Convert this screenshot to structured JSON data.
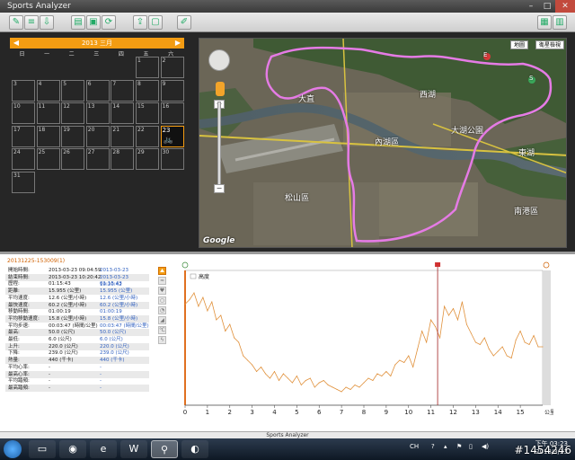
{
  "window": {
    "title": "Sports Analyzer"
  },
  "calendar": {
    "month_label": "2013 三月",
    "dows": [
      "日",
      "一",
      "二",
      "三",
      "四",
      "五",
      "六"
    ],
    "days": [
      "1",
      "2",
      "3",
      "4",
      "5",
      "6",
      "7",
      "8",
      "9",
      "10",
      "11",
      "12",
      "13",
      "14",
      "15",
      "16",
      "17",
      "18",
      "19",
      "20",
      "21",
      "22",
      "23",
      "24",
      "25",
      "26",
      "27",
      "28",
      "29",
      "30",
      "31"
    ],
    "selected_day": "23",
    "first_weekday": 5
  },
  "map": {
    "type_buttons": [
      "地圖",
      "衛星檢視"
    ],
    "labels": [
      "內湖區",
      "松山區",
      "大直",
      "大湖公園",
      "西湖",
      "東湖",
      "南港區"
    ],
    "google_logo": "Google",
    "route_markers": [
      "S",
      "E"
    ]
  },
  "activity": {
    "file_name": "20131225-153009(1)",
    "stats": [
      {
        "k": "開始時間:",
        "v1": "2013-03-23 09:04:59",
        "v2": "2013-03-23 09:04:59"
      },
      {
        "k": "結束時間:",
        "v1": "2013-03-23 10:20:42",
        "v2": "2013-03-23 10:20:42"
      },
      {
        "k": "歷程:",
        "v1": "01:15:43",
        "v2": "01:15:43"
      },
      {
        "k": "距離:",
        "v1": "15.955 (公里)",
        "v2": "15.955 (公里)"
      },
      {
        "k": "平均速度:",
        "v1": "12.6 (公里/小時)",
        "v2": "12.6 (公里/小時)"
      },
      {
        "k": "最快速度:",
        "v1": "60.2 (公里/小時)",
        "v2": "60.2 (公里/小時)"
      },
      {
        "k": "移動時間:",
        "v1": "01:00:19",
        "v2": "01:00:19"
      },
      {
        "k": "平均移動速度:",
        "v1": "15.8 (公里/小時)",
        "v2": "15.8 (公里/小時)"
      },
      {
        "k": "平均步速:",
        "v1": "00:03:47 (時間/公里)",
        "v2": "00:03:47 (時間/公里)"
      },
      {
        "k": "最高:",
        "v1": "50.0 (公尺)",
        "v2": "50.0 (公尺)"
      },
      {
        "k": "最低:",
        "v1": "6.0 (公尺)",
        "v2": "6.0 (公尺)"
      },
      {
        "k": "上升:",
        "v1": "220.0 (公尺)",
        "v2": "220.0 (公尺)"
      },
      {
        "k": "下降:",
        "v1": "239.0 (公尺)",
        "v2": "239.0 (公尺)"
      },
      {
        "k": "熱量:",
        "v1": "440 (千卡)",
        "v2": "440 (千卡)"
      },
      {
        "k": "平均心率:",
        "v1": "-",
        "v2": "-"
      },
      {
        "k": "最高心率:",
        "v1": "-",
        "v2": "-"
      },
      {
        "k": "平均踏頻:",
        "v1": "-",
        "v2": "-"
      },
      {
        "k": "最高踏頻:",
        "v1": "-",
        "v2": "-"
      }
    ]
  },
  "chart_data": {
    "type": "line",
    "legend": [
      "高度"
    ],
    "xlabel": "",
    "x_unit_label": "公里",
    "xlim": [
      0,
      16
    ],
    "ylim": [
      0,
      60
    ],
    "x_ticks": [
      "0",
      "1",
      "2",
      "3",
      "4",
      "5",
      "6",
      "7",
      "8",
      "9",
      "10",
      "11",
      "12",
      "13",
      "14",
      "15"
    ],
    "series": [
      {
        "name": "高度",
        "x": [
          0,
          0.2,
          0.4,
          0.6,
          0.8,
          1.0,
          1.2,
          1.4,
          1.6,
          1.8,
          2.0,
          2.2,
          2.4,
          2.6,
          2.8,
          3.0,
          3.2,
          3.4,
          3.6,
          3.8,
          4.0,
          4.2,
          4.4,
          4.6,
          4.8,
          5.0,
          5.2,
          5.4,
          5.6,
          5.8,
          6.0,
          6.2,
          6.4,
          6.6,
          6.8,
          7.0,
          7.2,
          7.4,
          7.6,
          7.8,
          8.0,
          8.2,
          8.4,
          8.6,
          8.8,
          9.0,
          9.2,
          9.4,
          9.6,
          9.8,
          10.0,
          10.2,
          10.4,
          10.6,
          10.8,
          11.0,
          11.2,
          11.4,
          11.6,
          11.8,
          12.0,
          12.2,
          12.4,
          12.6,
          12.8,
          13.0,
          13.2,
          13.4,
          13.6,
          13.8,
          14.0,
          14.2,
          14.4,
          14.6,
          14.8,
          15.0,
          15.2,
          15.4,
          15.6,
          15.8,
          16.0
        ],
        "values": [
          45,
          47,
          50,
          44,
          48,
          42,
          46,
          38,
          40,
          33,
          36,
          30,
          28,
          22,
          20,
          18,
          15,
          17,
          14,
          12,
          15,
          11,
          14,
          12,
          10,
          13,
          9,
          11,
          12,
          8,
          10,
          11,
          9,
          8,
          7,
          6,
          8,
          7,
          9,
          8,
          10,
          12,
          11,
          14,
          13,
          15,
          13,
          18,
          20,
          19,
          22,
          17,
          25,
          33,
          28,
          38,
          35,
          30,
          44,
          40,
          43,
          38,
          46,
          36,
          32,
          28,
          27,
          30,
          25,
          22,
          24,
          26,
          22,
          21,
          29,
          33,
          28,
          27,
          31,
          26,
          26
        ]
      }
    ],
    "marker_x": 11.3,
    "grid": false
  },
  "statusbar": {
    "text": "Sports Analyzer"
  },
  "taskbar": {
    "clock_time": "下午 03:23",
    "clock_date": "2013/3/23",
    "tray_lang": "CH"
  },
  "watermark": "#1454246"
}
